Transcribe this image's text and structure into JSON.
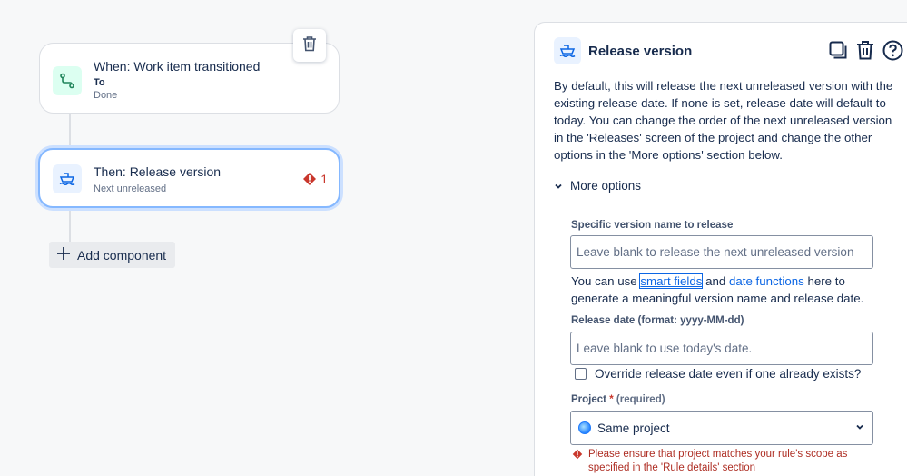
{
  "trigger": {
    "title": "When: Work item transitioned",
    "label": "To",
    "value": "Done"
  },
  "action": {
    "title": "Then: Release version",
    "subtitle": "Next unreleased",
    "error_count": "1"
  },
  "add_component_label": "Add component",
  "panel": {
    "title": "Release version",
    "description": "By default, this will release the next unreleased version with the existing release date. If none is set, release date will default to today. You can change the order of the next unreleased version in the 'Releases' screen of the project and change the other options in the 'More options' section below.",
    "more_options_label": "More options",
    "version_field": {
      "label": "Specific version name to release",
      "placeholder": "Leave blank to release the next unreleased version"
    },
    "helper": {
      "prefix": "You can use ",
      "smart_fields": "smart fields",
      "and": " and ",
      "date_functions": "date functions",
      "suffix": " here to generate a meaningful version name and release date."
    },
    "date_field": {
      "label": "Release date (format: yyyy-MM-dd)",
      "placeholder": "Leave blank to use today's date."
    },
    "override_label": "Override release date even if one already exists?",
    "project_field": {
      "label": "Project",
      "required_star": "*",
      "required_text": "(required)",
      "value": "Same project"
    },
    "error_message": "Please ensure that project matches your rule's scope as specified in the 'Rule details' section"
  },
  "colors": {
    "accent": "#0c66e4",
    "error": "#c9372c",
    "selected_border": "#85b8ff"
  }
}
